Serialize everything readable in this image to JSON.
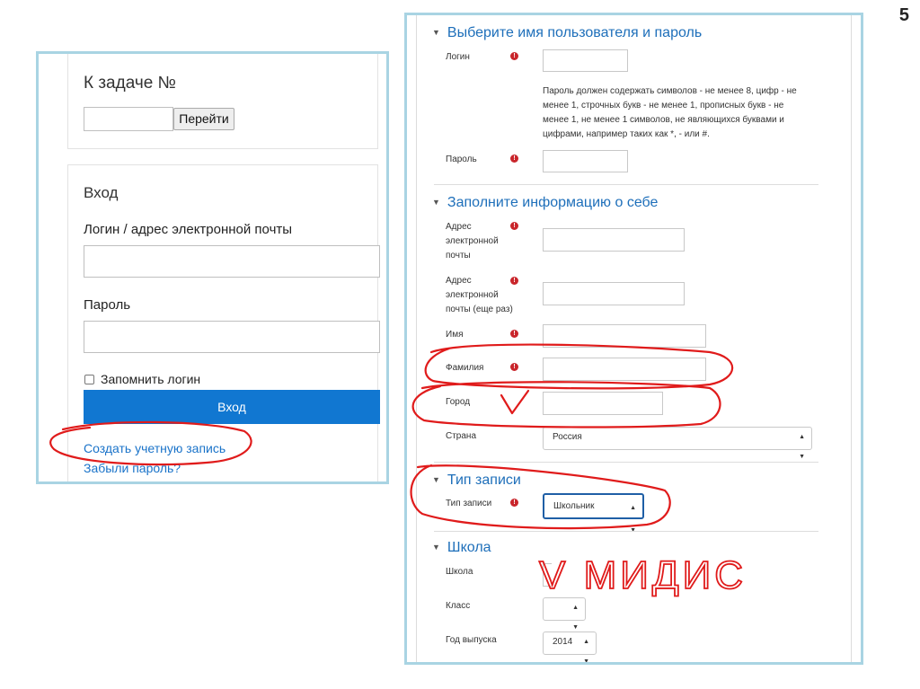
{
  "slide": {
    "number": "5"
  },
  "left": {
    "task": {
      "heading": "К задаче №",
      "input_value": "",
      "go_button": "Перейти"
    },
    "login": {
      "heading": "Вход",
      "username_label": "Логин / адрес электронной почты",
      "username_value": "",
      "password_label": "Пароль",
      "password_value": "",
      "remember_label": "Запомнить логин",
      "remember_checked": false,
      "submit_button": "Вход",
      "create_account_link": "Создать учетную запись",
      "forgot_password_link": "Забыли пароль?"
    }
  },
  "right": {
    "sections": {
      "credentials": "Выберите имя пользователя и пароль",
      "about": "Заполните информацию о себе",
      "account_type": "Тип записи",
      "school": "Школа"
    },
    "fields": {
      "login_label": "Логин",
      "password_help": [
        "Пароль должен содержать символов - не менее 8, цифр - не",
        "менее 1, строчных букв - не менее 1, прописных букв - не",
        "менее 1, не менее 1 символов, не являющихся буквами и",
        "цифрами, например таких как *, - или #."
      ],
      "password_label": "Пароль",
      "email_label": [
        "Адрес",
        "электронной",
        "почты"
      ],
      "email_again_label": [
        "Адрес",
        "электронной",
        "почты (еще раз)"
      ],
      "first_name_label": "Имя",
      "last_name_label": "Фамилия",
      "city_label": "Город",
      "country_label": "Страна",
      "country_value": "Россия",
      "account_type_label": "Тип записи",
      "account_type_value": "Школьник",
      "school_label": "Школа",
      "class_label": "Класс",
      "class_value": "",
      "grad_year_label": "Год выпуска",
      "grad_year_value": "2014"
    }
  },
  "annotations": {
    "handwritten_school": "V МИДИС",
    "city_check": "V",
    "color": "#e01b1b"
  },
  "icons": {
    "required": "exclamation-circle-icon",
    "collapse": "caret-down-icon",
    "select": "updown-arrows-icon"
  }
}
